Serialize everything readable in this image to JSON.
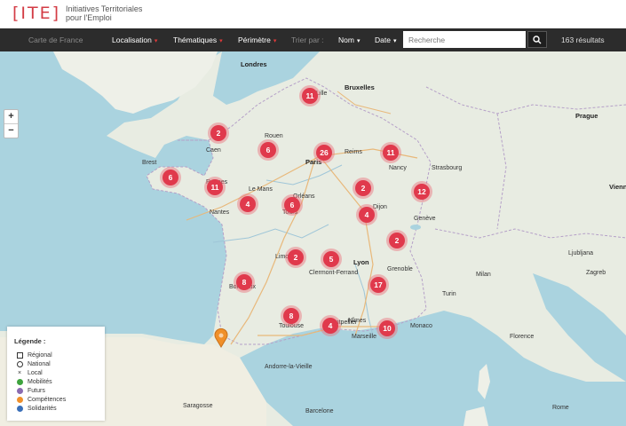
{
  "header": {
    "logo_mark": "[ITE]",
    "logo_text": "Initiatives Territoriales pour l'Emploi"
  },
  "nav": {
    "map_link": "Carte de France",
    "localisation": "Localisation",
    "thematiques": "Thématiques",
    "perimetre": "Périmètre",
    "trier_par": "Trier par :",
    "sort_nom": "Nom",
    "sort_date": "Date",
    "search_placeholder": "Recherche",
    "results": "163 résultats"
  },
  "map": {
    "zoom_in": "+",
    "zoom_out": "−",
    "clusters": [
      "11",
      "2",
      "6",
      "26",
      "11",
      "6",
      "11",
      "4",
      "6",
      "2",
      "12",
      "4",
      "2",
      "2",
      "5",
      "8",
      "17",
      "8",
      "4",
      "10"
    ],
    "labels": [
      "Londres",
      "Bruxelles",
      "Paris",
      "Nantes",
      "Bordeaux",
      "Lyon",
      "Toulouse",
      "Marseille",
      "Monaco",
      "Genève",
      "Brest",
      "Rennes",
      "Le Mans",
      "Tours",
      "Limoges",
      "Clermont-Ferrand",
      "Dijon",
      "Nancy",
      "Strasbourg",
      "Reims",
      "Lille",
      "Rouen",
      "Caen",
      "Orléans",
      "Montpellier",
      "Nîmes",
      "Grenoble",
      "Prague",
      "Vienne",
      "Ljubljana",
      "Zagreb",
      "Milan",
      "Turin",
      "Florence",
      "Rome",
      "Barcelone",
      "Andorre-la-Vieille",
      "Saragosse"
    ]
  },
  "legend": {
    "title": "Légende :",
    "items": [
      {
        "label": "Régional",
        "icon": "square-outline-icon",
        "color": "#333333"
      },
      {
        "label": "National",
        "icon": "circle-outline-icon",
        "color": "#333333"
      },
      {
        "label": "Local",
        "icon": "cross-icon",
        "color": "#333333"
      },
      {
        "label": "Mobilités",
        "icon": "dot-icon",
        "color": "#3ea33e"
      },
      {
        "label": "Futurs",
        "icon": "dot-icon",
        "color": "#8a6bb0"
      },
      {
        "label": "Compétences",
        "icon": "dot-icon",
        "color": "#f0902a"
      },
      {
        "label": "Solidarités",
        "icon": "dot-icon",
        "color": "#3a6fb8"
      }
    ]
  },
  "colors": {
    "accent": "#e0394c",
    "navbar": "#2c2c2c",
    "pin": "#f0902a"
  }
}
